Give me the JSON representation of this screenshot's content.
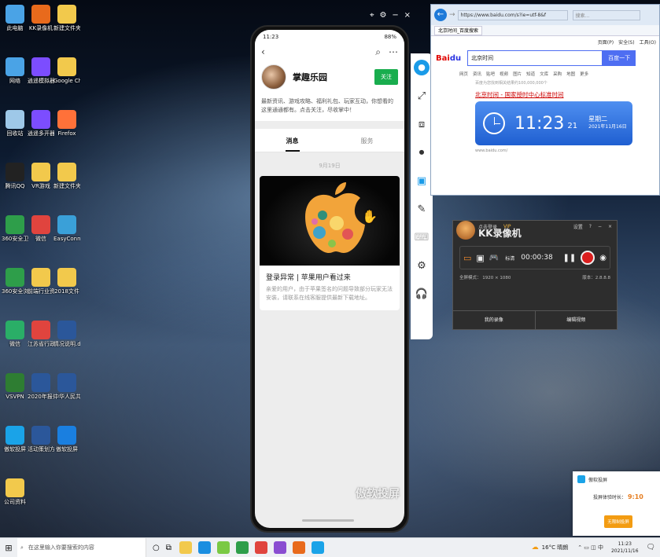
{
  "desktop": {
    "icons": [
      {
        "label": "此电脑",
        "color": "#4aa3e6"
      },
      {
        "label": "KK录像机",
        "color": "#e86a1c"
      },
      {
        "label": "新建文件夹(4)",
        "color": "#f2c94c"
      },
      {
        "label": "网络",
        "color": "#4aa3e6"
      },
      {
        "label": "逍遥模拟器",
        "color": "#7c4dff"
      },
      {
        "label": "Google Chrome",
        "color": "#f2c94c"
      },
      {
        "label": "回收站",
        "color": "#9ec8e8"
      },
      {
        "label": "逍遥多开器",
        "color": "#7c4dff"
      },
      {
        "label": "Firefox",
        "color": "#ff7139"
      },
      {
        "label": "腾讯QQ",
        "color": "#222222"
      },
      {
        "label": "VR游戏",
        "color": "#f2c94c"
      },
      {
        "label": "新建文件夹",
        "color": "#f2c94c"
      },
      {
        "label": "360安全卫士",
        "color": "#2e9e4a"
      },
      {
        "label": "微信",
        "color": "#e0443e"
      },
      {
        "label": "EasyConn",
        "color": "#3aa0d8"
      },
      {
        "label": "360安全浏览器",
        "color": "#2e9e4a"
      },
      {
        "label": "前端行业资料",
        "color": "#f2c94c"
      },
      {
        "label": "2018文件",
        "color": "#f2c94c"
      },
      {
        "label": "微信",
        "color": "#2aae67"
      },
      {
        "label": "江苏省行政区划",
        "color": "#e0443e"
      },
      {
        "label": "情况说明.docx",
        "color": "#2b579a"
      },
      {
        "label": "VSVPN",
        "color": "#2e7d32"
      },
      {
        "label": "2020年报告",
        "color": "#2b579a"
      },
      {
        "label": "中华人民共和国",
        "color": "#2b579a"
      },
      {
        "label": "傲软投屏",
        "color": "#1aa3e8"
      },
      {
        "label": "活动策划方案.doc",
        "color": "#2b579a"
      },
      {
        "label": "傲软投屏",
        "color": "#1a7fe0"
      },
      {
        "label": "公司资料",
        "color": "#f2c94c"
      }
    ]
  },
  "phone": {
    "status_time": "11:23",
    "status_battery": "88%",
    "account_name": "掌趣乐园",
    "follow_label": "关注",
    "description": "最新资讯、游戏攻略、福利礼包、玩家互动，你想看的这里通通都有。点击关注，尽收掌中！",
    "tabs": [
      "消息",
      "服务"
    ],
    "date_label": "9月19日",
    "article_title": "登录异常 | 苹果用户看过来",
    "article_body": "亲爱的用户，由于苹果签名的问题导致部分玩家无法安装，请联系在线客服提供最新下载地址。",
    "watermark": "傲软投屏",
    "top_controls": [
      "⌖",
      "⚙",
      "−",
      "×"
    ]
  },
  "browser": {
    "url": "https://www.baidu.com/s?ie=utf-8&f",
    "search_box": "搜索...",
    "tab_title": "北京时间_百度搜索",
    "menu": [
      "页面(P)",
      "安全(S)",
      "工具(O)"
    ],
    "query": "北京时间",
    "search_button": "百度一下",
    "nav_tabs": [
      "网页",
      "资讯",
      "贴吧",
      "视频",
      "图片",
      "知道",
      "文库",
      "采购",
      "地图",
      "更多"
    ],
    "result_count": "百度为您找到相关结果约100,000,000个",
    "result_title": "北京时间 - 国家授时中心标准时间",
    "clock_time": "11:23",
    "clock_seconds": "21",
    "clock_weekday": "星期二",
    "clock_date": "2021年11月16日",
    "result_url": "www.baidu.com/"
  },
  "recorder": {
    "top_link": "点击登录",
    "vip": "VIP",
    "settings": "设置",
    "help": "?",
    "title": "KK录像机",
    "mode_label": "标清",
    "timer": "00:00:38",
    "resolution": "全屏模式： 1920 × 1080",
    "version": "版本：2.8.8.8",
    "bottom_buttons": [
      "我的录像",
      "编辑视频"
    ]
  },
  "notification": {
    "app_name": "傲软投屏",
    "label": "投屏体验时长：",
    "duration": "9:10",
    "button": "无限制投屏"
  },
  "taskbar": {
    "search_placeholder": "在这里输入你要搜索的内容",
    "weather": "16°C 晴朗",
    "time": "11:23",
    "date": "2021/11/16"
  }
}
